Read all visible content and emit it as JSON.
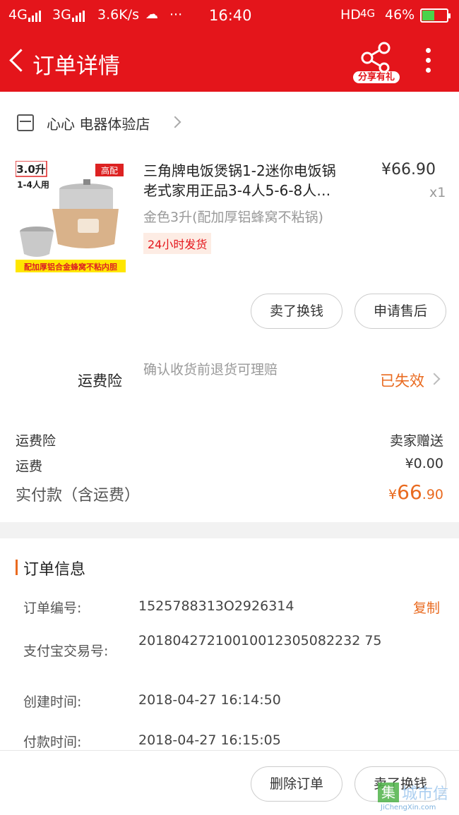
{
  "status_bar": {
    "net1": "4G",
    "net2": "3G",
    "speed": "3.6K/s",
    "dots": "···",
    "time": "16:40",
    "hd": "HD",
    "net3": "4G",
    "battery": "46%"
  },
  "header": {
    "title": "订单详情",
    "share_label": "分享有礼"
  },
  "shop": {
    "name": "心心 电器体验店"
  },
  "product": {
    "title_line1": "三角牌电饭煲锅1-2迷你电饭锅",
    "title_line2": "老式家用正品3-4人5-6-8人…",
    "price": "¥66.90",
    "qty": "x1",
    "sku": "金色3升(配加厚铝蜂窝不粘锅)",
    "tag": "24小时发货",
    "image_badge_capacity": "3.0升",
    "image_badge_people": "1-4人用",
    "image_badge_high": "高配",
    "image_banner": "配加厚铝合金蜂窝不粘内胆"
  },
  "actions": {
    "sell_label": "卖了换钱",
    "aftersale_label": "申请售后"
  },
  "insurance": {
    "label": "运费险",
    "desc": "确认收货前退货可理赔",
    "status": "已失效"
  },
  "summary": {
    "ins_label": "运费险",
    "ins_value": "卖家赠送",
    "ship_label": "运费",
    "ship_value": "¥0.00",
    "total_label": "实付款（含运费）",
    "total_currency": "¥",
    "total_int": "66",
    "total_dec": ".90"
  },
  "order_info": {
    "section_title": "订单信息",
    "order_no_label": "订单编号:",
    "order_no": "1525788313O2926314",
    "copy_label": "复制",
    "alipay_label": "支付宝交易号:",
    "alipay_no": "20180427210010012305082232 75",
    "created_label": "创建时间:",
    "created": "2018-04-27 16:14:50",
    "paid_label": "付款时间:",
    "paid": "2018-04-27 16:15:05"
  },
  "bottom": {
    "delete_label": "删除订单",
    "sell_label": "卖了换钱"
  },
  "watermark": {
    "box": "集",
    "cn": "城市信",
    "en": "JiChengXin.com"
  },
  "colors": {
    "brand_red": "#e4151b",
    "accent_orange": "#e96a1f"
  }
}
